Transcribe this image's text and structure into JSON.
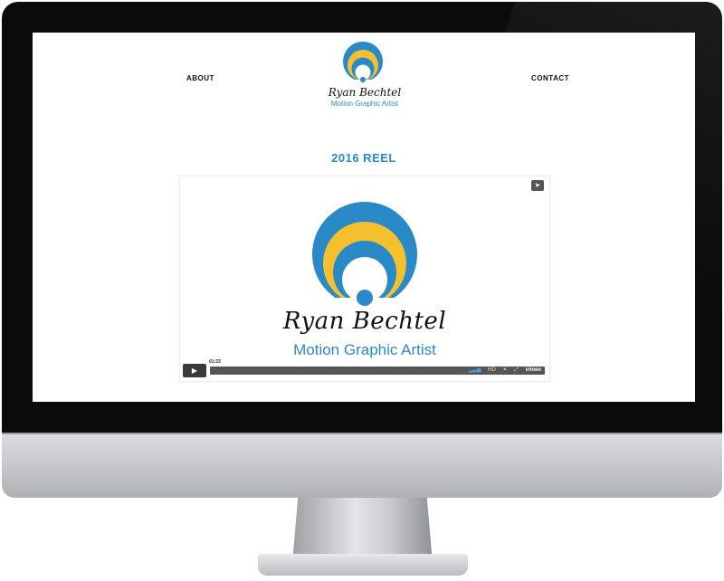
{
  "nav": {
    "about": "ABOUT",
    "contact": "CONTACT"
  },
  "logo": {
    "name": "Ryan Bechtel",
    "subtitle": "Motion Graphic Artist"
  },
  "page": {
    "reel_title": "2016 REEL"
  },
  "video": {
    "name": "Ryan Bechtel",
    "subtitle": "Motion Graphic Artist",
    "timecode": "01:23",
    "hd_label": "HD",
    "vimeo_label": "vimeo",
    "icons": [
      "share-icon",
      "play-icon",
      "volume-icon",
      "settings-icon",
      "fullscreen-icon"
    ]
  },
  "colors": {
    "accent_blue": "#2a8ac8",
    "accent_yellow": "#f5c02e",
    "bezel": "#0b0b0b"
  }
}
